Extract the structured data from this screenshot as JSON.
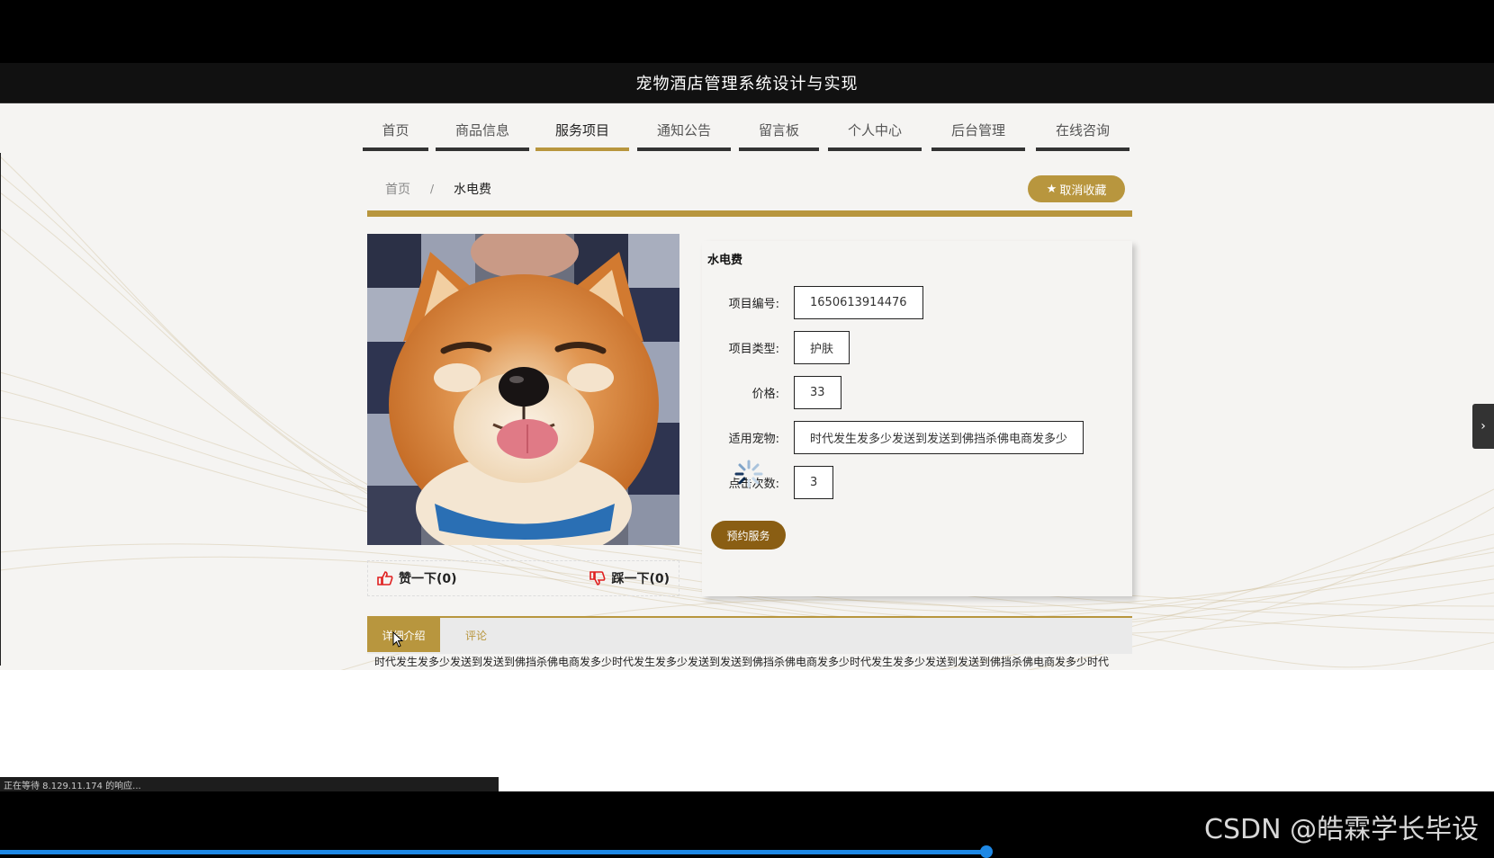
{
  "header": {
    "title": "宠物酒店管理系统设计与实现"
  },
  "nav": {
    "items": [
      {
        "label": "首页",
        "active": false
      },
      {
        "label": "商品信息",
        "active": false
      },
      {
        "label": "服务项目",
        "active": true
      },
      {
        "label": "通知公告",
        "active": false
      },
      {
        "label": "留言板",
        "active": false
      },
      {
        "label": "个人中心",
        "active": false
      },
      {
        "label": "后台管理",
        "active": false
      },
      {
        "label": "在线咨询",
        "active": false
      }
    ]
  },
  "breadcrumb": {
    "home": "首页",
    "separator": "/",
    "current": "水电费"
  },
  "favorite_button": {
    "label": "取消收藏",
    "icon": "star-icon"
  },
  "product": {
    "title": "水电费",
    "fields": [
      {
        "label": "项目编号:",
        "value": "1650613914476"
      },
      {
        "label": "项目类型:",
        "value": "护肤"
      },
      {
        "label": "价格:",
        "value": "33"
      },
      {
        "label": "适用宠物:",
        "value": "时代发生发多少发送到发送到佛挡杀佛电商发多少"
      },
      {
        "label": "点击次数:",
        "value": "3"
      }
    ],
    "book_button": "预约服务",
    "image_alt": "shiba-inu-dog-photo"
  },
  "votes": {
    "like": "赞一下(0)",
    "dislike": "踩一下(0)"
  },
  "tabs": [
    {
      "label": "详细介绍",
      "active": true
    },
    {
      "label": "评论",
      "active": false
    }
  ],
  "description": "时代发生发多少发送到发送到佛挡杀佛电商发多少时代发生发多少发送到发送到佛挡杀佛电商发多少时代发生发多少发送到发送到佛挡杀佛电商发多少时代",
  "status_bar": "正在等待 8.129.11.174 的响应...",
  "watermark": "CSDN @皓霖学长毕设",
  "video_progress": 0.66,
  "colors": {
    "accent": "#b8963e",
    "book_button": "#8a5e13",
    "header_bg": "#111111"
  }
}
